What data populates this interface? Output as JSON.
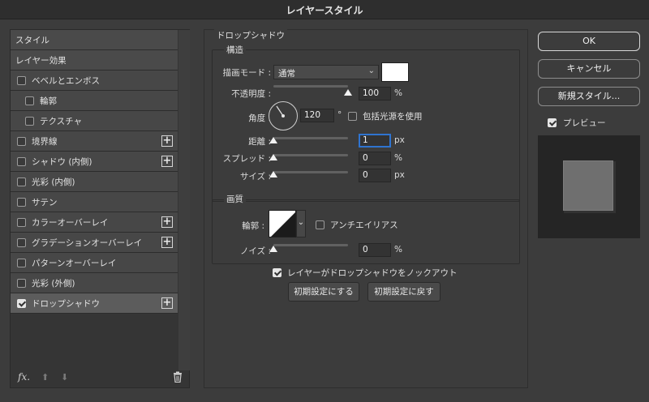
{
  "window": {
    "title": "レイヤースタイル"
  },
  "left_list": {
    "items": [
      {
        "label": "スタイル",
        "type": "header"
      },
      {
        "label": "レイヤー効果",
        "type": "header"
      },
      {
        "label": "ベベルとエンボス",
        "type": "check",
        "checked": false
      },
      {
        "label": "輪郭",
        "type": "check",
        "checked": false,
        "indent": true
      },
      {
        "label": "テクスチャ",
        "type": "check",
        "checked": false,
        "indent": true
      },
      {
        "label": "境界線",
        "type": "check",
        "checked": false,
        "plus": true
      },
      {
        "label": "シャドウ (内側)",
        "type": "check",
        "checked": false,
        "plus": true
      },
      {
        "label": "光彩 (内側)",
        "type": "check",
        "checked": false
      },
      {
        "label": "サテン",
        "type": "check",
        "checked": false
      },
      {
        "label": "カラーオーバーレイ",
        "type": "check",
        "checked": false,
        "plus": true
      },
      {
        "label": "グラデーションオーバーレイ",
        "type": "check",
        "checked": false,
        "plus": true
      },
      {
        "label": "パターンオーバーレイ",
        "type": "check",
        "checked": false
      },
      {
        "label": "光彩 (外側)",
        "type": "check",
        "checked": false
      },
      {
        "label": "ドロップシャドウ",
        "type": "check",
        "checked": true,
        "plus": true,
        "selected": true
      }
    ],
    "footer": {
      "fx_label": "fx",
      "fx_sub": "."
    }
  },
  "drop_shadow": {
    "section_title": "ドロップシャドウ",
    "structure": {
      "title": "構造",
      "blend_mode_label": "描画モード :",
      "blend_mode_value": "通常",
      "shadow_color": "#ffffff",
      "opacity_label": "不透明度 :",
      "opacity_value": "100",
      "opacity_percent": 100,
      "opacity_unit": "%",
      "angle_label": "角度 :",
      "angle_value": "120",
      "angle_unit": "°",
      "global_light_label": "包括光源を使用",
      "global_light_checked": false,
      "distance_label": "距離 :",
      "distance_value": "1",
      "distance_unit": "px",
      "spread_label": "スプレッド :",
      "spread_value": "0",
      "spread_unit": "%",
      "size_label": "サイズ :",
      "size_value": "0",
      "size_unit": "px"
    },
    "quality": {
      "title": "画質",
      "contour_label": "輪郭 :",
      "antialias_label": "アンチエイリアス",
      "antialias_checked": false,
      "noise_label": "ノイズ :",
      "noise_value": "0",
      "noise_unit": "%"
    },
    "knockout_label": "レイヤーがドロップシャドウをノックアウト",
    "knockout_checked": true,
    "make_default_label": "初期設定にする",
    "reset_default_label": "初期設定に戻す"
  },
  "right": {
    "ok_label": "OK",
    "cancel_label": "キャンセル",
    "new_style_label": "新規スタイル...",
    "preview_label": "プレビュー",
    "preview_checked": true
  }
}
